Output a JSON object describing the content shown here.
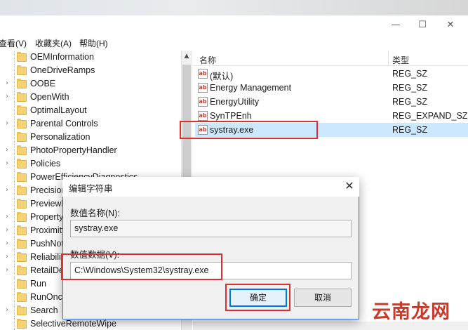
{
  "window": {
    "controls": [
      "—",
      "☐",
      "✕"
    ]
  },
  "menu": [
    {
      "label": "查看(V)"
    },
    {
      "label": "收藏夹(A)"
    },
    {
      "label": "帮助(H)"
    }
  ],
  "tree": {
    "items": [
      {
        "label": "OEMInformation",
        "expandable": false
      },
      {
        "label": "OneDriveRamps",
        "expandable": false
      },
      {
        "label": "OOBE",
        "expandable": true
      },
      {
        "label": "OpenWith",
        "expandable": true
      },
      {
        "label": "OptimalLayout",
        "expandable": false
      },
      {
        "label": "Parental Controls",
        "expandable": true
      },
      {
        "label": "Personalization",
        "expandable": false
      },
      {
        "label": "PhotoPropertyHandler",
        "expandable": true
      },
      {
        "label": "Policies",
        "expandable": true
      },
      {
        "label": "PowerEfficiencyDiagnostics",
        "expandable": false
      },
      {
        "label": "PrecisionTouchPad",
        "expandable": true
      },
      {
        "label": "PreviewHandlers",
        "expandable": false
      },
      {
        "label": "PropertySystem",
        "expandable": true
      },
      {
        "label": "Proximity",
        "expandable": true
      },
      {
        "label": "PushNotifications",
        "expandable": true
      },
      {
        "label": "Reliability",
        "expandable": true
      },
      {
        "label": "RetailDemo",
        "expandable": true
      },
      {
        "label": "Run",
        "expandable": false
      },
      {
        "label": "RunOnce",
        "expandable": false
      },
      {
        "label": "Search",
        "expandable": true
      },
      {
        "label": "SelectiveRemoteWipe",
        "expandable": false
      }
    ]
  },
  "values_list": {
    "columns": {
      "name": "名称",
      "type": "类型"
    },
    "rows": [
      {
        "name": "(默认)",
        "type": "REG_SZ"
      },
      {
        "name": "Energy Management",
        "type": "REG_SZ"
      },
      {
        "name": "EnergyUtility",
        "type": "REG_SZ"
      },
      {
        "name": "SynTPEnh",
        "type": "REG_EXPAND_SZ"
      },
      {
        "name": "systray.exe",
        "type": "REG_SZ",
        "selected": true
      }
    ]
  },
  "dialog": {
    "title": "编辑字符串",
    "value_name_label": "数值名称(N):",
    "value_name": "systray.exe",
    "value_data_label": "数值数据(V):",
    "value_data": "C:\\Windows\\System32\\systray.exe",
    "ok_label": "确定",
    "cancel_label": "取消",
    "close_glyph": "✕"
  },
  "watermark": {
    "text": "云南龙网"
  },
  "colors": {
    "highlight": "#d9312f",
    "selection": "#cce8ff",
    "accent": "#0078d7",
    "folder": "#f5d274"
  }
}
